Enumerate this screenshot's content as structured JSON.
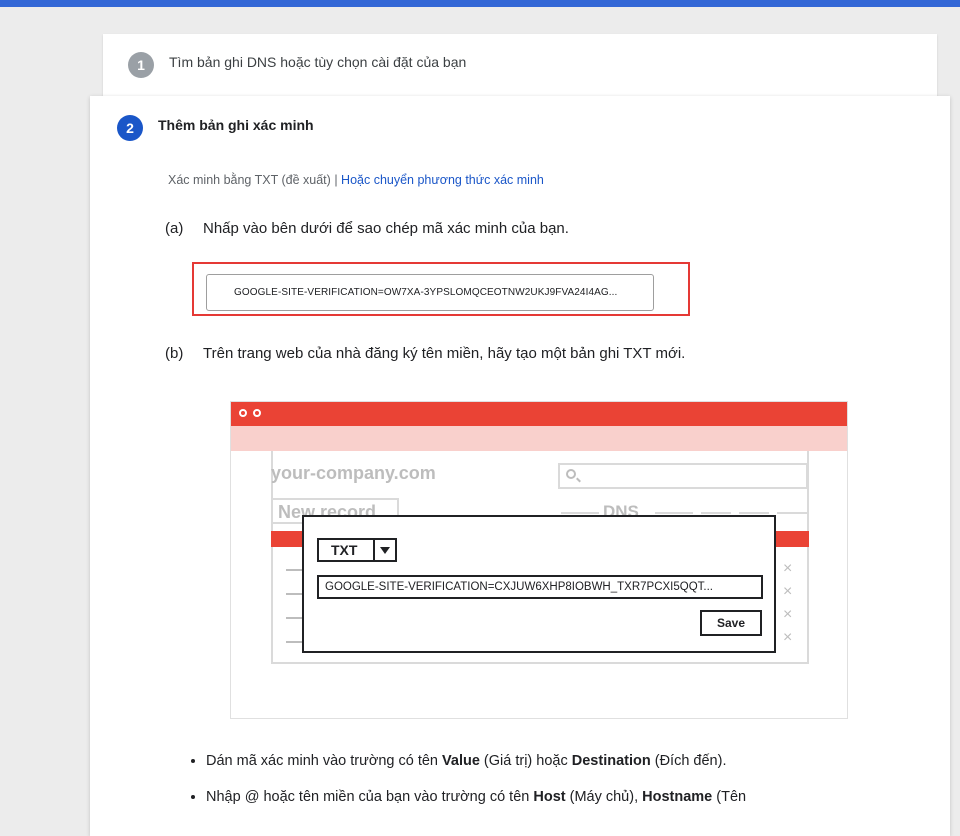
{
  "step1": {
    "number": "1",
    "title": "Tìm bản ghi DNS hoặc tùy chọn cài đặt của bạn"
  },
  "step2": {
    "number": "2",
    "title": "Thêm bản ghi xác minh",
    "method_label": "Xác minh bằng TXT (đề xuất)",
    "separator": "|",
    "switch_link": "Hoặc chuyển phương thức xác minh",
    "sub_a": {
      "label": "(a)",
      "text": "Nhấp vào bên dưới để sao chép mã xác minh của bạn."
    },
    "verification_code": "GOOGLE-SITE-VERIFICATION=OW7XA-3YPSLOMQCEOTNW2UKJ9FVA24I4AG...",
    "sub_b": {
      "label": "(b)",
      "text": "Trên trang web của nhà đăng ký tên miền, hãy tạo một bản ghi TXT mới."
    },
    "illustration": {
      "domain": "your-company.com",
      "new_record": "New record",
      "dns": "DNS",
      "record_type": "TXT",
      "record_value": "GOOGLE-SITE-VERIFICATION=CXJUW6XHP8IOBWH_TXR7PCXI5QQT...",
      "save": "Save",
      "x_mark": "×"
    },
    "bullets": [
      {
        "p1": "Dán mã xác minh vào trường có tên ",
        "b1": "Value",
        "p2": " (Giá trị) hoặc ",
        "b2": "Destination",
        "p3": " (Đích đến)."
      },
      {
        "p1": "Nhập @ hoặc tên miền của bạn vào trường có tên ",
        "b1": "Host",
        "p2": " (Máy chủ), ",
        "b2": "Hostname",
        "p3": " (Tên"
      }
    ]
  },
  "colors": {
    "accent": "#1a56c8",
    "highlight_border": "#e53935",
    "illustration_red": "#ea4335",
    "illustration_pink": "#f9d0cc"
  }
}
